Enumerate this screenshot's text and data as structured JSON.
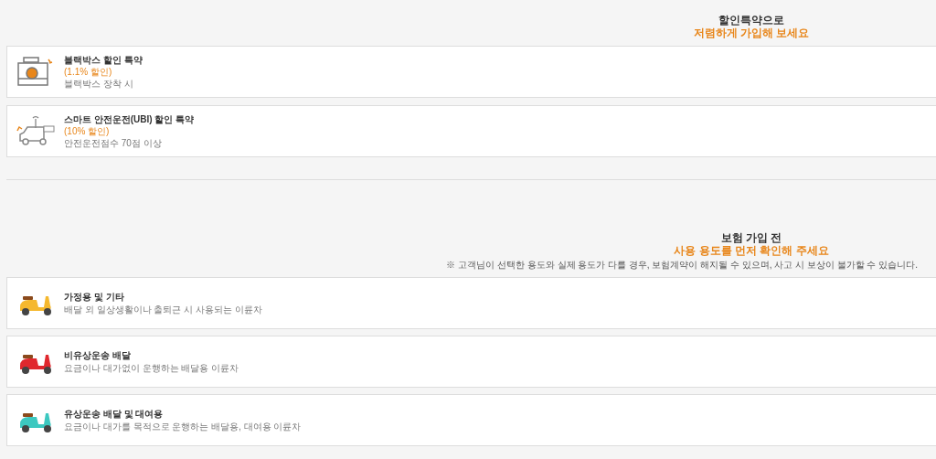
{
  "discount_section": {
    "heading": "할인특약으로",
    "subheading": "저렴하게 가입해 보세요",
    "items": [
      {
        "kind": "dashcam",
        "title": "블랙박스 할인 특약",
        "discount": "(1.1% 할인)",
        "condition": "블랙박스 장착 시"
      },
      {
        "kind": "car",
        "title": "스마트 안전운전(UBI) 할인 특약",
        "discount": "(10% 할인)",
        "condition": "안전운전점수 70점 이상"
      }
    ]
  },
  "usage_section": {
    "heading": "보험 가입 전",
    "subheading": "사용 용도를 먼저 확인해 주세요",
    "note": "※ 고객님이 선택한 용도와 실제 용도가 다를 경우, 보험계약이 해지될 수 있으며, 사고 시 보상이 불가할 수 있습니다.",
    "items": [
      {
        "color": "#f5b82e",
        "title": "가정용 및 기타",
        "description": "배달 외 일상생활이나 출퇴근 시 사용되는 이륜차"
      },
      {
        "color": "#e0282e",
        "title": "비유상운송 배달",
        "description": "요금이나 대가없이 운행하는 배달용 이륜차"
      },
      {
        "color": "#3cc8c0",
        "title": "유상운송 배달 및 대여용",
        "description": "요금이나 대가를 목적으로 운행하는 배달용, 대여용 이륜차"
      }
    ]
  }
}
